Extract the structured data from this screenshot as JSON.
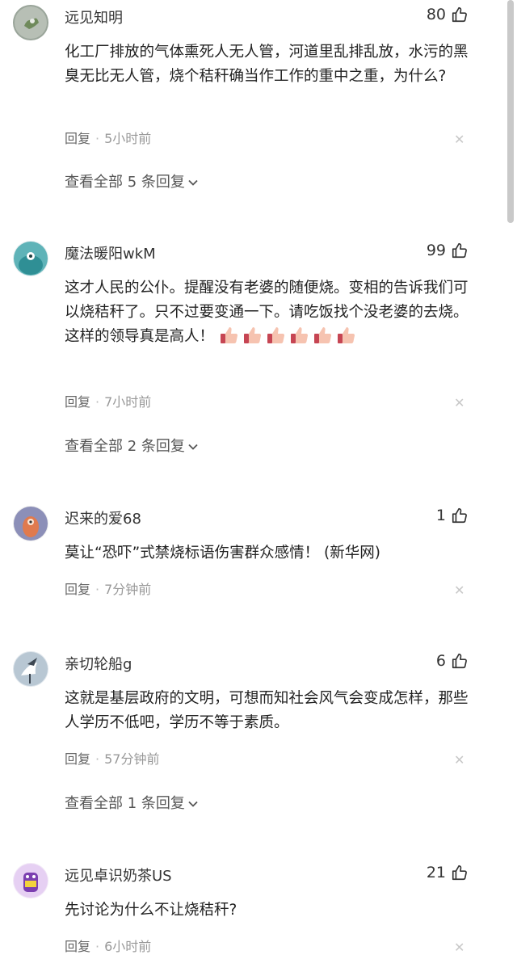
{
  "comments": [
    {
      "username": "远见知明",
      "likes": "80",
      "text": "化工厂排放的气体熏死人无人管，河道里乱排乱放，水污的黑臭无比无人管，烧个秸秆确当作工作的重中之重，为什么?",
      "reply_label": "回复",
      "time": "5小时前",
      "view_replies": "查看全部 5 条回复"
    },
    {
      "username": "魔法暖阳wkM",
      "likes": "99",
      "text": "这才人民的公仆。提醒没有老婆的随便烧。变相的告诉我们可以烧秸秆了。只不过要变通一下。请吃饭找个没老婆的去烧。这样的领导真是高人！",
      "reply_label": "回复",
      "time": "7小时前",
      "view_replies": "查看全部 2 条回复"
    },
    {
      "username": "迟来的爱68",
      "likes": "1",
      "text": "莫让“恐吓”式禁烧标语伤害群众感情！ (新华网)",
      "reply_label": "回复",
      "time": "7分钟前"
    },
    {
      "username": "亲切轮船g",
      "likes": "6",
      "text": "这就是基层政府的文明，可想而知社会风气会变成怎样，那些人学历不低吧，学历不等于素质。",
      "reply_label": "回复",
      "time": "57分钟前",
      "view_replies": "查看全部 1 条回复"
    },
    {
      "username": "远见卓识奶茶US",
      "likes": "21",
      "text": "先讨论为什么不让烧秸秆?",
      "reply_label": "回复",
      "time": "6小时前"
    }
  ],
  "icons": {
    "like": "thumbs-up-icon",
    "close": "close-icon",
    "expand": "chevron-down-icon",
    "emoji": "thumbs-up-emoji"
  },
  "colors": {
    "text": "#222222",
    "meta": "#999999",
    "close": "#c8c8c8"
  }
}
